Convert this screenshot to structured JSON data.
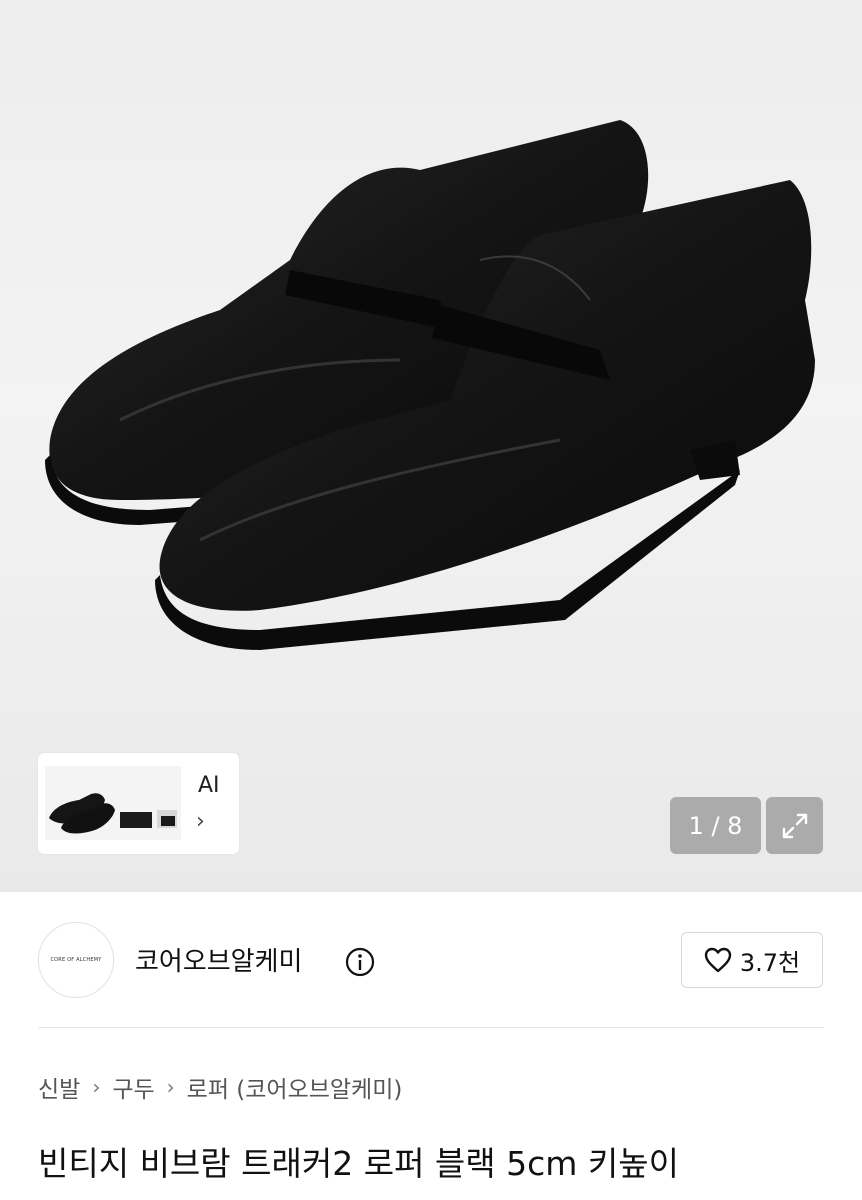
{
  "gallery": {
    "counter": "1 / 8",
    "ai_label": "AI",
    "ai_chevron": "›",
    "expand_icon": "expand-icon"
  },
  "brand": {
    "logo_text": "CORE OF ALCHEMY",
    "name": "코어오브알케미",
    "info_icon": "info-icon"
  },
  "like": {
    "icon": "heart-icon",
    "count": "3.7천"
  },
  "breadcrumb": {
    "items": [
      "신발",
      "구두",
      "로퍼 (코어오브알케미)"
    ],
    "separator": "›"
  },
  "product": {
    "title": "빈티지 비브람 트래커2 로퍼 블랙 5cm 키높이"
  },
  "colors": {
    "hero_bg": "#efefef",
    "shoe": "#151515",
    "overlay": "#969696"
  }
}
